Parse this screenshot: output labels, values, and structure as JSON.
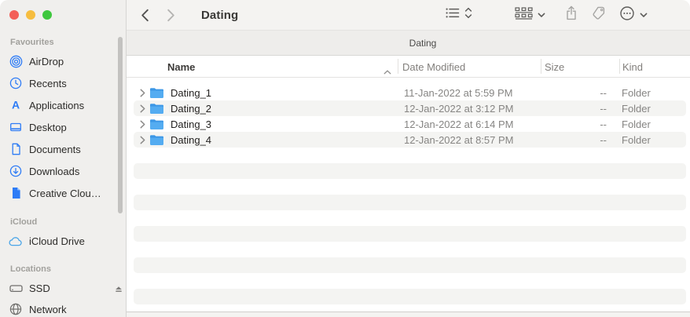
{
  "window": {
    "title": "Dating",
    "controls": [
      "close",
      "minimize",
      "zoom"
    ]
  },
  "toolbar": {
    "title": "Dating",
    "icons": [
      "back-chevron",
      "forward-chevron",
      "list-view",
      "view-picker-chevrons",
      "group-by",
      "group-by-chevron",
      "share",
      "tag",
      "more-options",
      "more-options-chevron"
    ]
  },
  "tabbar": {
    "tab_title": "Dating"
  },
  "sidebar": {
    "sections": [
      {
        "label": "Favourites",
        "items": [
          {
            "label": "AirDrop",
            "icon": "airdrop-icon"
          },
          {
            "label": "Recents",
            "icon": "clock-icon"
          },
          {
            "label": "Applications",
            "icon": "applications-icon"
          },
          {
            "label": "Desktop",
            "icon": "desktop-icon"
          },
          {
            "label": "Documents",
            "icon": "document-icon"
          },
          {
            "label": "Downloads",
            "icon": "download-icon"
          },
          {
            "label": "Creative Clou…",
            "icon": "creative-cloud-icon"
          }
        ]
      },
      {
        "label": "iCloud",
        "items": [
          {
            "label": "iCloud Drive",
            "icon": "cloud-icon"
          }
        ]
      },
      {
        "label": "Locations",
        "items": [
          {
            "label": "SSD",
            "icon": "drive-icon",
            "eject": true
          },
          {
            "label": "Network",
            "icon": "globe-icon"
          }
        ]
      }
    ]
  },
  "list": {
    "columns": [
      {
        "label": "Name",
        "sorted": "ascending"
      },
      {
        "label": "Date Modified"
      },
      {
        "label": "Size"
      },
      {
        "label": "Kind"
      }
    ],
    "rows": [
      {
        "name": "Dating_1",
        "date_modified": "11-Jan-2022 at 5:59 PM",
        "size": "--",
        "kind": "Folder"
      },
      {
        "name": "Dating_2",
        "date_modified": "12-Jan-2022 at 3:12 PM",
        "size": "--",
        "kind": "Folder"
      },
      {
        "name": "Dating_3",
        "date_modified": "12-Jan-2022 at 6:14 PM",
        "size": "--",
        "kind": "Folder"
      },
      {
        "name": "Dating_4",
        "date_modified": "12-Jan-2022 at 8:57 PM",
        "size": "--",
        "kind": "Folder"
      }
    ]
  },
  "colors": {
    "sidebar_icon_blue": "#2e7cf6",
    "folder_body_blue": "#54acf1",
    "folder_tab_blue": "#3c97e6",
    "row_stripe": "#f4f4f2",
    "traffic_red": "#f35f58",
    "traffic_yellow": "#f6bd3f",
    "traffic_green": "#3ec73e"
  }
}
